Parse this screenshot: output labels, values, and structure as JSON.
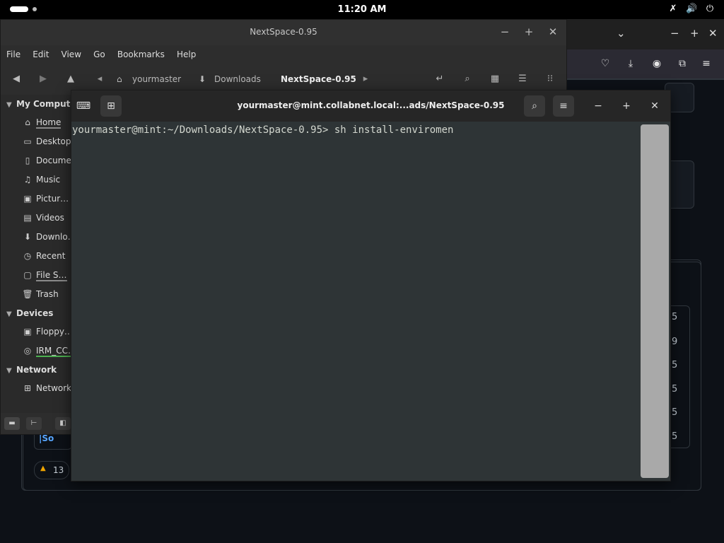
{
  "topbar": {
    "clock": "11:20 AM"
  },
  "browser": {
    "badge_count": "13",
    "repo_text": "So",
    "table_numbers": [
      "5",
      "9",
      "5",
      "5",
      "5",
      "5"
    ]
  },
  "file_manager": {
    "title": "NextSpace-0.95",
    "menu": [
      "File",
      "Edit",
      "View",
      "Go",
      "Bookmarks",
      "Help"
    ],
    "breadcrumbs": [
      "yourmaster",
      "Downloads",
      "NextSpace-0.95"
    ],
    "sidebar": {
      "my_computer": "My Computer",
      "items": [
        "Home",
        "Desktop",
        "Documents",
        "Music",
        "Pictures",
        "Videos",
        "Downloads",
        "Recent",
        "File System",
        "Trash"
      ],
      "devices_label": "Devices",
      "devices": [
        "Floppy Disk",
        "IRM_CCSA"
      ],
      "network_label": "Network",
      "network": [
        "Network"
      ]
    }
  },
  "terminal": {
    "title": "yourmaster@mint.collabnet.local:...ads/NextSpace-0.95",
    "prompt": "yourmaster@mint:~/Downloads/NextSpace-0.95> ",
    "command": "sh install-enviromen"
  }
}
